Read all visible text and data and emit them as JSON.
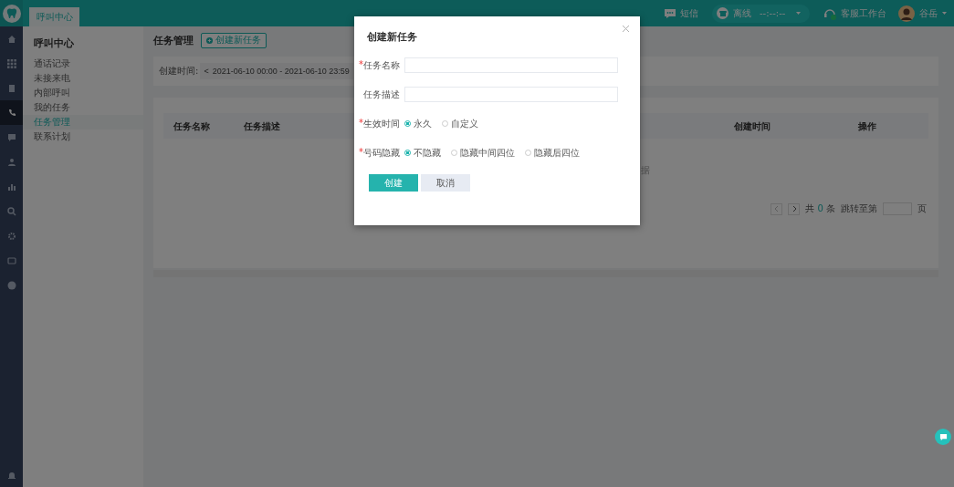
{
  "topbar": {
    "tab": "呼叫中心",
    "sms": "短信",
    "status": {
      "label": "离线",
      "timer": "--:--:--"
    },
    "workbench": "客服工作台",
    "user": "谷岳"
  },
  "rail": {
    "items": [
      {
        "kind": "home",
        "selected": false
      },
      {
        "kind": "grid",
        "selected": false
      },
      {
        "kind": "doc",
        "selected": false
      },
      {
        "kind": "phone",
        "selected": true
      },
      {
        "kind": "chat",
        "selected": false
      },
      {
        "kind": "person",
        "selected": false
      },
      {
        "kind": "chart",
        "selected": false
      },
      {
        "kind": "search",
        "selected": false
      },
      {
        "kind": "gear",
        "selected": false
      },
      {
        "kind": "screen",
        "selected": false
      },
      {
        "kind": "circle",
        "selected": false
      }
    ]
  },
  "sidebar": {
    "title": "呼叫中心",
    "items": [
      {
        "label": "通话记录",
        "selected": false
      },
      {
        "label": "未接来电",
        "selected": false
      },
      {
        "label": "内部呼叫",
        "selected": false
      },
      {
        "label": "我的任务",
        "selected": false
      },
      {
        "label": "任务管理",
        "selected": true
      },
      {
        "label": "联系计划",
        "selected": false
      }
    ]
  },
  "page": {
    "title": "任务管理",
    "create_button": "创建新任务",
    "filter": {
      "label": "创建时间:",
      "prev": "<",
      "range": "2021-06-10 00:00 - 2021-06-10 23:59"
    },
    "table": {
      "columns": [
        "任务名称",
        "任务描述",
        "创建时间",
        "操作"
      ],
      "empty": "据"
    },
    "pagination": {
      "total_prefix": "共",
      "total": "0",
      "total_suffix": "条",
      "jump": "跳转至第",
      "page_suffix": "页"
    }
  },
  "dialog": {
    "title": "创建新任务",
    "fields": [
      {
        "kind": "text",
        "label": "任务名称",
        "required_mark": "*"
      },
      {
        "kind": "text",
        "label": "任务描述"
      },
      {
        "kind": "radio",
        "label": "生效时间",
        "required_mark": "*",
        "options": [
          {
            "label": "永久",
            "selected": true
          },
          {
            "label": "自定义",
            "selected": false
          }
        ]
      },
      {
        "kind": "radio",
        "label": "号码隐藏",
        "required_mark": "*",
        "options": [
          {
            "label": "不隐藏",
            "selected": true
          },
          {
            "label": "隐藏中间四位",
            "selected": false
          },
          {
            "label": "隐藏后四位",
            "selected": false
          }
        ]
      }
    ],
    "buttons": [
      {
        "kind": "primary",
        "label": "创建"
      },
      {
        "kind": "secondary",
        "label": "取消"
      }
    ]
  }
}
